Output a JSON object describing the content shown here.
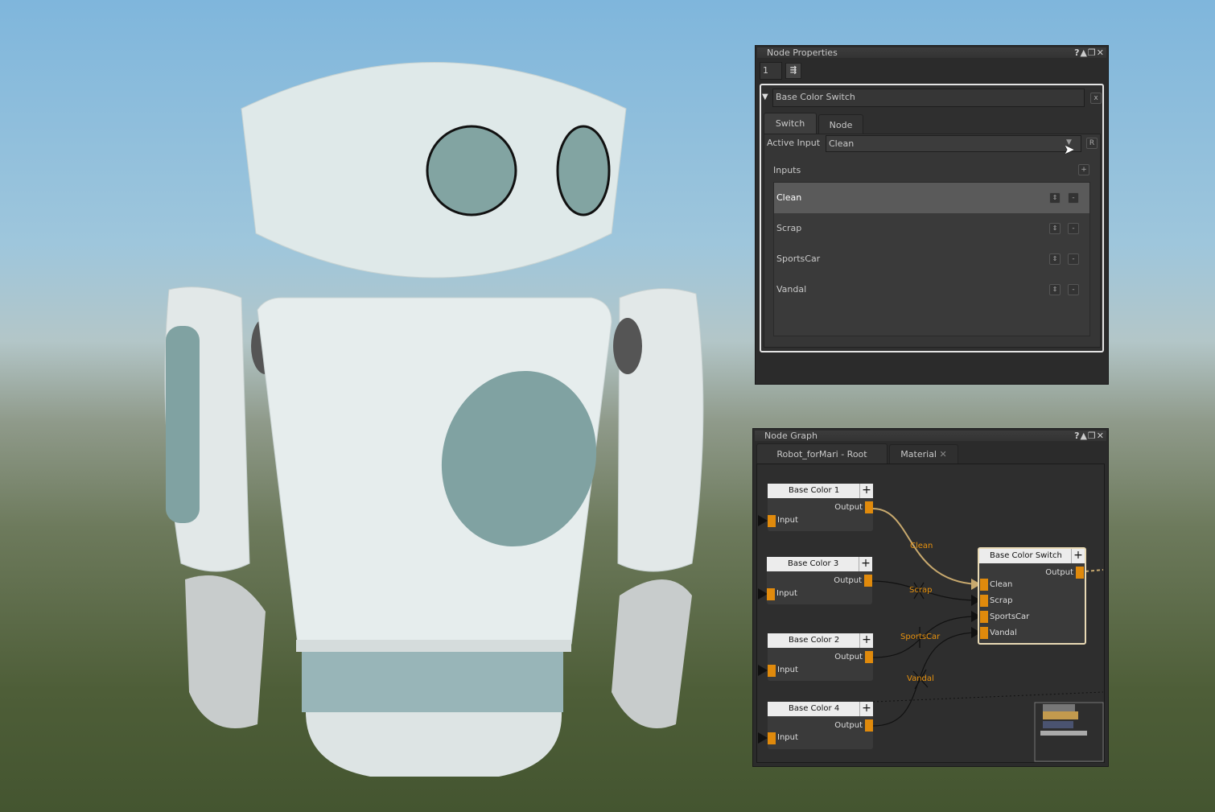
{
  "viewport": {
    "subject": "robot-3d-model"
  },
  "node_properties": {
    "title": "Node Properties",
    "window_buttons": "?▲❐✕",
    "count_value": "1",
    "clear_icon": "clear-icon",
    "node_name": "Base Color Switch",
    "close_label": "x",
    "tabs": [
      {
        "label": "Switch",
        "active": true
      },
      {
        "label": "Node",
        "active": false
      }
    ],
    "active_input_label": "Active Input",
    "active_input_value": "Clean",
    "reset_label": "R",
    "inputs_label": "Inputs",
    "add_label": "+",
    "remove_label": "-",
    "inputs": [
      {
        "label": "Clean",
        "selected": true
      },
      {
        "label": "Scrap"
      },
      {
        "label": "SportsCar"
      },
      {
        "label": "Vandal"
      }
    ]
  },
  "node_graph": {
    "title": "Node Graph",
    "window_buttons": "?▲❐✕",
    "tabs": [
      {
        "label": "Robot_forMari - Root"
      },
      {
        "label": "Material",
        "close": "✕"
      }
    ],
    "nodes": [
      {
        "title": "Base Color 1",
        "output": "Output",
        "input": "Input"
      },
      {
        "title": "Base Color 3",
        "output": "Output",
        "input": "Input"
      },
      {
        "title": "Base Color 2",
        "output": "Output",
        "input": "Input"
      },
      {
        "title": "Base Color 4",
        "output": "Output",
        "input": "Input"
      }
    ],
    "switch_node": {
      "title": "Base Color Switch",
      "output": "Output",
      "inputs": [
        "Clean",
        "Scrap",
        "SportsCar",
        "Vandal"
      ]
    },
    "edge_labels": [
      "Clean",
      "Scrap",
      "SportsCar",
      "Vandal"
    ],
    "plus": "+",
    "colors": {
      "port": "#e08a0c",
      "active_edge": "#c8a96e",
      "label": "#e8920e"
    }
  }
}
